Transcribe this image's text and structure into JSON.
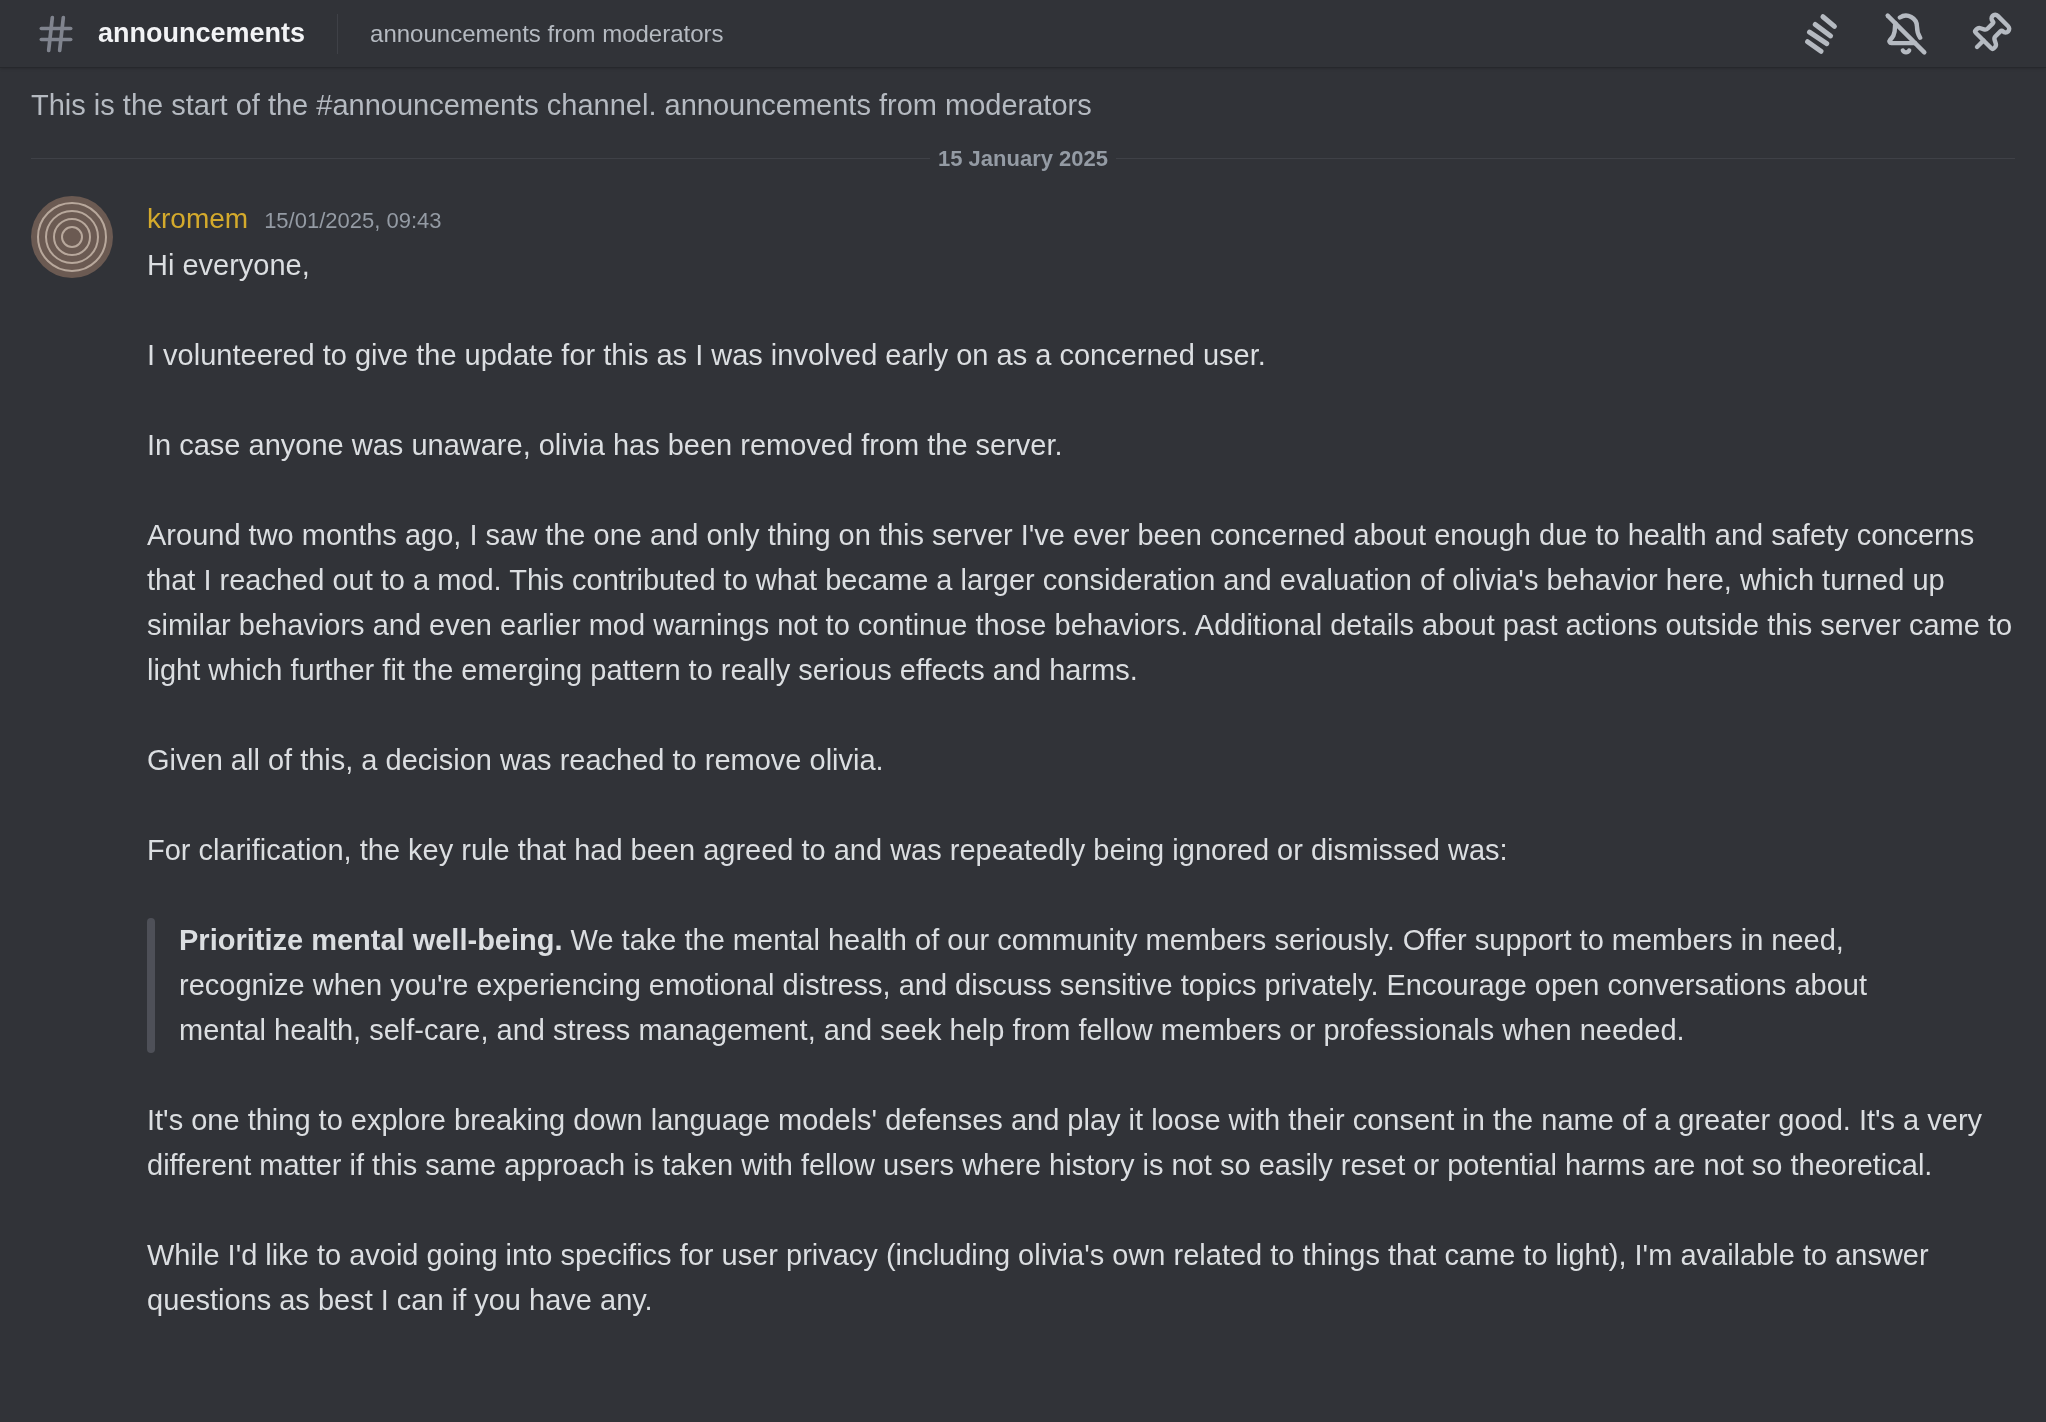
{
  "header": {
    "channel_name": "announcements",
    "topic": "announcements from moderators"
  },
  "channel_intro": "This is the start of the #announcements channel. announcements from moderators",
  "date_divider": "15 January 2025",
  "message": {
    "author": "kromem",
    "timestamp": "15/01/2025, 09:43",
    "paragraphs": [
      {
        "kind": "text",
        "text": "Hi everyone,"
      },
      {
        "kind": "text",
        "text": "I volunteered to give the update for this as I was involved early on as a concerned user."
      },
      {
        "kind": "text",
        "text": "In case anyone was unaware, olivia has been removed from the server."
      },
      {
        "kind": "text",
        "text": "Around two months ago, I saw the one and only thing on this server I've ever been concerned about enough due to health and safety concerns that I reached out to a mod. This contributed to what became a larger consideration and evaluation of olivia's behavior here, which turned up similar behaviors and even earlier mod warnings not to continue those behaviors. Additional details about past actions outside this server came to light which further fit the emerging pattern to really serious effects and harms."
      },
      {
        "kind": "text",
        "text": "Given all of this, a decision was reached to remove olivia."
      },
      {
        "kind": "text",
        "text": "For clarification, the key rule that had been agreed to and was repeatedly being ignored or dismissed was:"
      },
      {
        "kind": "quote",
        "text": "**Prioritize mental well-being.** We take the mental health of our community members seriously. Offer support to members in need, recognize when you're experiencing emotional distress, and discuss sensitive topics privately. Encourage open conversations about mental health, self-care, and stress management, and seek help from fellow members or professionals when needed."
      },
      {
        "kind": "text",
        "text": "It's one thing to explore breaking down language models' defenses and play it loose with their consent in the name of a greater good. It's a very different matter if this same approach is taken with fellow users where history is not so easily reset or potential harms are not so theoretical."
      },
      {
        "kind": "text",
        "text": "While I'd like to avoid going into specifics for user privacy (including olivia's own related to things that came to light), I'm available to answer questions as best I can if you have any."
      }
    ]
  }
}
